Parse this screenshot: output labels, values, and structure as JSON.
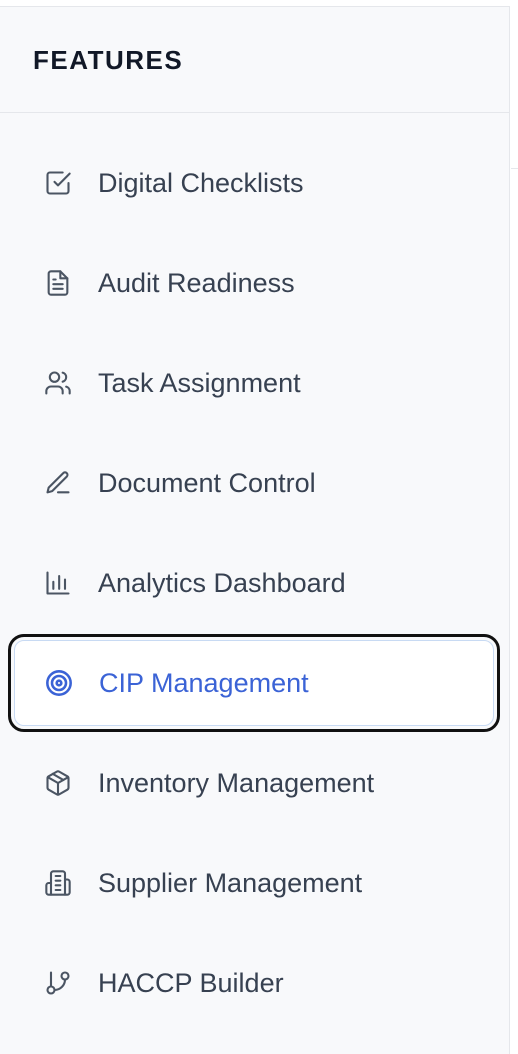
{
  "sidebar": {
    "title": "FEATURES",
    "items": [
      {
        "label": "Digital Checklists",
        "icon": "checkbox-icon",
        "active": false
      },
      {
        "label": "Audit Readiness",
        "icon": "document-icon",
        "active": false
      },
      {
        "label": "Task Assignment",
        "icon": "users-icon",
        "active": false
      },
      {
        "label": "Document Control",
        "icon": "pencil-icon",
        "active": false
      },
      {
        "label": "Analytics Dashboard",
        "icon": "bar-chart-icon",
        "active": false
      },
      {
        "label": "CIP Management",
        "icon": "target-icon",
        "active": true
      },
      {
        "label": "Inventory Management",
        "icon": "package-icon",
        "active": false
      },
      {
        "label": "Supplier Management",
        "icon": "building-icon",
        "active": false
      },
      {
        "label": "HACCP Builder",
        "icon": "git-branch-icon",
        "active": false
      }
    ]
  },
  "colors": {
    "accent": "#3b63d6",
    "text": "#374151",
    "background": "#f8f9fb"
  }
}
